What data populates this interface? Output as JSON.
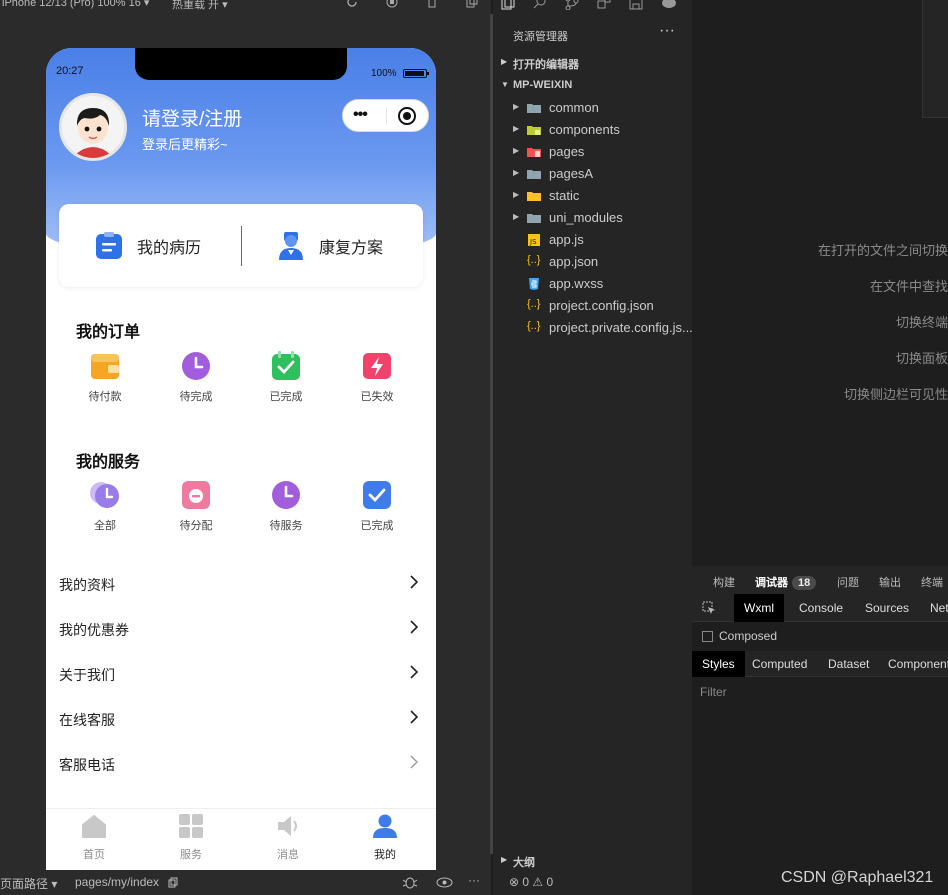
{
  "simulator": {
    "device": "iPhone 12/13 (Pro) 100% 16 ▾",
    "hot_reload": "热重载 开 ▾",
    "status_time": "20:27",
    "battery": "100%",
    "bottom_path_label": "页面路径 ▾",
    "bottom_path": "pages/my/index"
  },
  "profile": {
    "title": "请登录/注册",
    "subtitle": "登录后更精彩~"
  },
  "quick_card": {
    "left_label": "我的病历",
    "right_label": "康复方案"
  },
  "orders": {
    "title": "我的订单",
    "items": [
      {
        "label": "待付款",
        "icon": "wallet-icon",
        "color": "#f5a623"
      },
      {
        "label": "待完成",
        "icon": "clock-icon",
        "color": "#a25ddc"
      },
      {
        "label": "已完成",
        "icon": "calendar-check-icon",
        "color": "#2fbf5e"
      },
      {
        "label": "已失效",
        "icon": "lightning-icon",
        "color": "#f0426a"
      }
    ]
  },
  "services": {
    "title": "我的服务",
    "items": [
      {
        "label": "全部",
        "icon": "clock-icon",
        "color": "#9a7ce8"
      },
      {
        "label": "待分配",
        "icon": "minus-badge-icon",
        "color": "#f07a9f"
      },
      {
        "label": "待服务",
        "icon": "clock-icon",
        "color": "#a25ddc"
      },
      {
        "label": "已完成",
        "icon": "check-shield-icon",
        "color": "#3f7be9"
      }
    ]
  },
  "menu": [
    {
      "label": "我的资料"
    },
    {
      "label": "我的优惠券"
    },
    {
      "label": "关于我们"
    },
    {
      "label": "在线客服"
    },
    {
      "label": "客服电话"
    }
  ],
  "tabbar": [
    {
      "label": "首页",
      "icon": "home-icon"
    },
    {
      "label": "服务",
      "icon": "grid-icon"
    },
    {
      "label": "消息",
      "icon": "speaker-icon"
    },
    {
      "label": "我的",
      "icon": "user-icon"
    }
  ],
  "explorer": {
    "header": "资源管理器",
    "more": "···",
    "open_editors": "打开的编辑器",
    "project": "MP-WEIXIN",
    "items": [
      {
        "name": "common",
        "type": "folder"
      },
      {
        "name": "components",
        "type": "folder"
      },
      {
        "name": "pages",
        "type": "folder"
      },
      {
        "name": "pagesA",
        "type": "folder"
      },
      {
        "name": "static",
        "type": "folder"
      },
      {
        "name": "uni_modules",
        "type": "folder"
      },
      {
        "name": "app.js",
        "type": "js"
      },
      {
        "name": "app.json",
        "type": "json"
      },
      {
        "name": "app.wxss",
        "type": "css"
      },
      {
        "name": "project.config.json",
        "type": "json"
      },
      {
        "name": "project.private.config.js...",
        "type": "json"
      }
    ],
    "outline": "大纲",
    "status": "⊗ 0 ⚠ 0"
  },
  "editor": {
    "hints": [
      "在打开的文件之间切换",
      "在文件中查找",
      "切换终端",
      "切换面板",
      "切换侧边栏可见性"
    ]
  },
  "debug": {
    "tabs": [
      "构建",
      "调试器",
      "问题",
      "输出",
      "终端"
    ],
    "badge": "18",
    "devtabs": [
      "Wxml",
      "Console",
      "Sources",
      "Network"
    ],
    "composed": "Composed",
    "styletabs": [
      "Styles",
      "Computed",
      "Dataset",
      "Component"
    ],
    "filter": "Filter"
  },
  "watermark": "CSDN @Raphael321"
}
